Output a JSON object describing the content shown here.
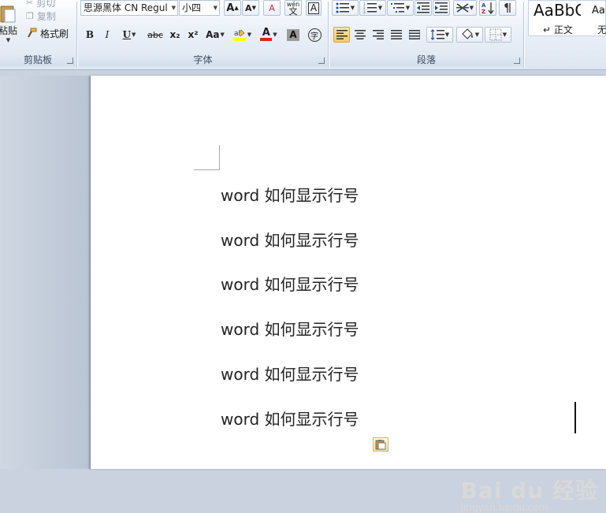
{
  "ribbon": {
    "clipboard": {
      "title": "剪贴板",
      "paste_label": "粘贴",
      "cut_label": "剪切",
      "copy_label": "复制",
      "format_painter_label": "格式刷"
    },
    "font": {
      "title": "字体",
      "font_name": "思源黑体 CN Regul",
      "font_size": "小四",
      "bold": "B",
      "italic": "I",
      "underline": "U",
      "strike": "abc",
      "subscript": "x₂",
      "superscript": "x²",
      "change_case": "Aa",
      "grow_font": "A",
      "shrink_font": "A",
      "clear_format": "A",
      "phonetic": "wén",
      "phonetic_char": "文",
      "char_border": "A",
      "font_color": "A",
      "char_shading": "A",
      "enclose": "字"
    },
    "paragraph": {
      "title": "段落"
    },
    "styles": {
      "items": [
        {
          "sample": "AaBbCcDc",
          "name": "↵ 正文"
        },
        {
          "sample": "AaBbCcDc",
          "name": "无间隔"
        }
      ]
    },
    "colors": {
      "highlight": "#ffff00",
      "font_color": "#e02020",
      "active_border": "#e2a23a"
    }
  },
  "document": {
    "lines": [
      "word 如何显示行号",
      "word 如何显示行号",
      "word 如何显示行号",
      "word 如何显示行号",
      "word 如何显示行号",
      "word 如何显示行号"
    ]
  },
  "watermark": {
    "brand": "Bai du 经验",
    "url": "jingyan.baidu.com"
  }
}
